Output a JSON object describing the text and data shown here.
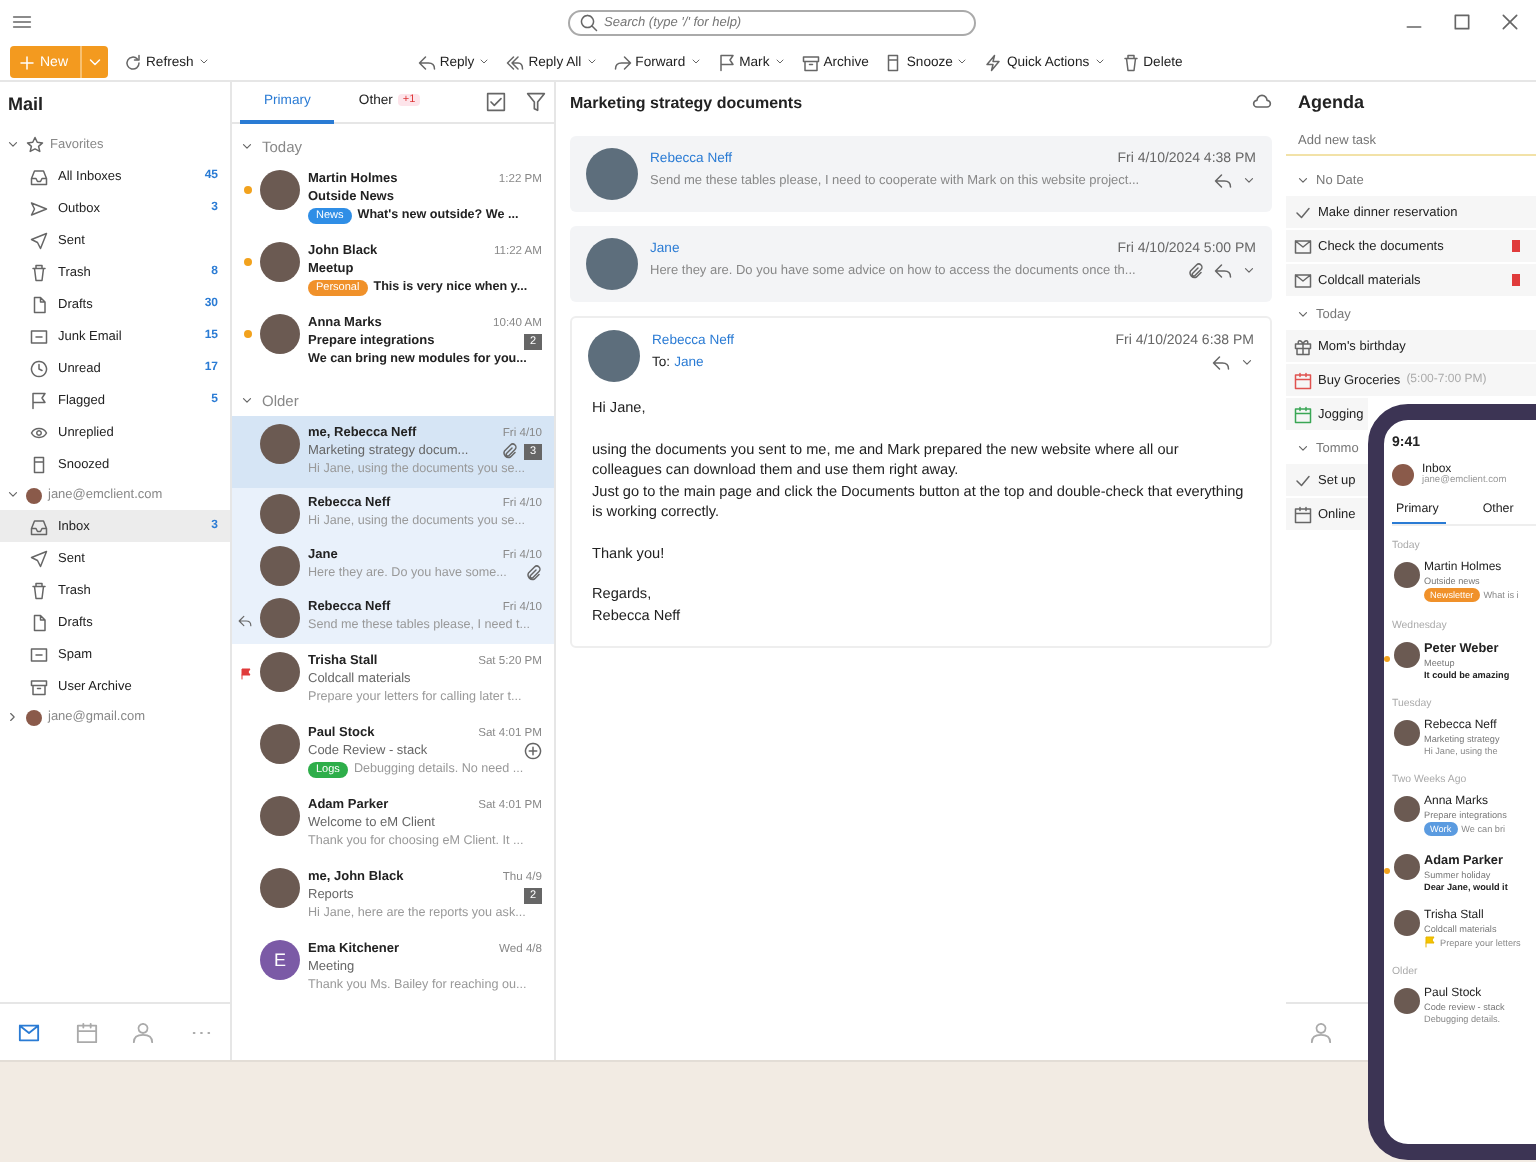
{
  "titlebar": {
    "search": {
      "placeholder": "Search (type '/' for help)"
    }
  },
  "toolbar": {
    "new_button": {
      "label": "New"
    },
    "refresh_button": {
      "label": "Refresh"
    },
    "actions": [
      {
        "label": "Reply",
        "kind": "reply",
        "dropdown": true
      },
      {
        "label": "Reply All",
        "kind": "replyall",
        "dropdown": true
      },
      {
        "label": "Forward",
        "kind": "forward",
        "dropdown": true
      },
      {
        "label": "Mark",
        "kind": "flag",
        "dropdown": true
      },
      {
        "label": "Archive",
        "kind": "archive",
        "dropdown": false
      },
      {
        "label": "Snooze",
        "kind": "snooze",
        "dropdown": true
      },
      {
        "label": "Quick Actions",
        "kind": "bolt",
        "dropdown": true
      },
      {
        "label": "Delete",
        "kind": "trash",
        "dropdown": false
      }
    ]
  },
  "sidebar": {
    "title": "Mail",
    "tree": [
      {
        "label": "Favorites",
        "kind": "favorites",
        "expanded": true,
        "children": [
          {
            "label": "All Inboxes",
            "kind": "inbox",
            "count": "45",
            "selected": false
          },
          {
            "label": "Outbox",
            "kind": "outbox",
            "count": "3",
            "selected": false
          },
          {
            "label": "Sent",
            "kind": "sent",
            "selected": false
          },
          {
            "label": "Trash",
            "kind": "trash",
            "count": "8",
            "selected": false
          },
          {
            "label": "Drafts",
            "kind": "draft",
            "count": "30",
            "selected": false
          },
          {
            "label": "Junk Email",
            "kind": "junk",
            "count": "15",
            "selected": false
          },
          {
            "label": "Unread",
            "kind": "unread",
            "count": "17",
            "selected": false
          },
          {
            "label": "Flagged",
            "kind": "flag",
            "count": "5",
            "selected": false
          },
          {
            "label": "Unreplied",
            "kind": "eye",
            "selected": false
          },
          {
            "label": "Snoozed",
            "kind": "snooze",
            "selected": false
          }
        ]
      },
      {
        "label": "jane@emclient.com",
        "kind": "account",
        "expanded": true,
        "children": [
          {
            "label": "Inbox",
            "kind": "inbox",
            "count": "3",
            "selected": true
          },
          {
            "label": "Sent",
            "kind": "sent",
            "selected": false
          },
          {
            "label": "Trash",
            "kind": "trash",
            "selected": false
          },
          {
            "label": "Drafts",
            "kind": "draft",
            "selected": false
          },
          {
            "label": "Spam",
            "kind": "junk",
            "selected": false
          },
          {
            "label": "User Archive",
            "kind": "archive",
            "selected": false
          }
        ]
      },
      {
        "label": "jane@gmail.com",
        "kind": "account",
        "expanded": false
      }
    ],
    "nav": [
      {
        "kind": "mail",
        "selected": true
      },
      {
        "kind": "calendar",
        "selected": false
      },
      {
        "kind": "contacts",
        "selected": false
      },
      {
        "kind": "more",
        "selected": false
      }
    ]
  },
  "message_list": {
    "tabs": [
      {
        "label": "Primary",
        "selected": true
      },
      {
        "label": "Other",
        "selected": false,
        "badge": "+1"
      }
    ],
    "groups": [
      {
        "label": "Today",
        "expanded": true,
        "messages": [
          {
            "sender": "Martin Holmes",
            "time": "1:22 PM",
            "subject": "Outside News",
            "preview": "What's new outside? We ...",
            "tag": {
              "label": "News",
              "color": "#2f8ee6"
            },
            "unread": true,
            "selected": false
          },
          {
            "sender": "John Black",
            "time": "11:22 AM",
            "subject": "Meetup",
            "preview": "This is very nice when y...",
            "tag": {
              "label": "Personal",
              "color": "#f0912a"
            },
            "unread": true,
            "selected": false
          },
          {
            "sender": "Anna Marks",
            "time": "10:40 AM",
            "subject": "Prepare integrations",
            "preview": "We can bring new modules for you...",
            "count": "2",
            "unread": true,
            "selected": false
          }
        ]
      },
      {
        "label": "Older",
        "expanded": true,
        "messages": [
          {
            "sender": "me, Rebecca Neff",
            "time": "Fri 4/10",
            "subject": "Marketing strategy docum...",
            "preview": "Hi Jane, using the documents you se...",
            "attachment": true,
            "count": "3",
            "unread": false,
            "selected": true
          },
          {
            "sender": "Rebecca Neff",
            "time": "Fri 4/10",
            "preview": "Hi Jane, using the documents you se...",
            "threaded": true,
            "unread": false,
            "selected": false
          },
          {
            "sender": "Jane",
            "time": "Fri 4/10",
            "preview": "Here they are. Do you have some...",
            "attachment": true,
            "threaded": true,
            "unread": false,
            "selected": false
          },
          {
            "sender": "Rebecca Neff",
            "time": "Fri 4/10",
            "preview": "Send me these tables please, I need t...",
            "threaded": true,
            "replied": true,
            "unread": false,
            "selected": false
          },
          {
            "sender": "Trisha Stall",
            "time": "Sat 5:20 PM",
            "subject": "Coldcall materials",
            "preview": "Prepare your letters for calling later t...",
            "flagged": true,
            "unread": false,
            "selected": false
          },
          {
            "sender": "Paul Stock",
            "time": "Sat 4:01 PM",
            "subject": "Code Review - stack",
            "preview": "Debugging details. No need ...",
            "tag": {
              "label": "Logs",
              "color": "#2eae4a"
            },
            "snoozed": true,
            "unread": false,
            "selected": false
          },
          {
            "sender": "Adam Parker",
            "time": "Sat 4:01 PM",
            "subject": "Welcome to eM Client",
            "preview": "Thank you for choosing eM Client. It ...",
            "unread": false,
            "selected": false
          },
          {
            "sender": "me, John Black",
            "time": "Thu 4/9",
            "subject": "Reports",
            "preview": "Hi Jane, here are the reports you ask...",
            "count": "2",
            "unread": false,
            "selected": false
          },
          {
            "sender": "Ema Kitchener",
            "time": "Wed 4/8",
            "subject": "Meeting",
            "preview": "Thank you Ms. Bailey for reaching ou...",
            "initial": "E",
            "unread": false,
            "selected": false
          }
        ]
      }
    ]
  },
  "reading_pane": {
    "title": "Marketing strategy documents",
    "messages": [
      {
        "sender": "Rebecca Neff",
        "date": "Fri 4/10/2024 4:38 PM",
        "snippet": "Send me these tables please, I need to cooperate with Mark on this website project...",
        "expanded": false,
        "attachment": false
      },
      {
        "sender": "Jane",
        "date": "Fri 4/10/2024 5:00 PM",
        "snippet": "Here they are. Do you have some advice on how to access the documents once th...",
        "expanded": false,
        "attachment": true
      },
      {
        "sender": "Rebecca Neff",
        "date": "Fri 4/10/2024 6:38 PM",
        "to_label": "To:",
        "to": "Jane",
        "expanded": true,
        "attachment": false,
        "body": [
          [
            "Hi Jane,"
          ],
          [
            "using the documents you sent to me, me and Mark prepared the new website where all our colleagues can download them and use them right away.",
            "Just go to the main page and click the Documents button at the top and double-check that everything is working correctly."
          ],
          [
            "Thank you!"
          ],
          [
            "Regards,",
            "Rebecca Neff"
          ]
        ]
      }
    ]
  },
  "agenda": {
    "title": "Agenda",
    "new_task": {
      "placeholder": "Add new task"
    },
    "groups": [
      {
        "label": "No Date",
        "expanded": true,
        "items": [
          {
            "label": "Make dinner reservation",
            "kind": "task",
            "flagged": false
          },
          {
            "label": "Check the documents",
            "kind": "mail",
            "flagged": true
          },
          {
            "label": "Coldcall materials",
            "kind": "mail",
            "flagged": true
          }
        ]
      },
      {
        "label": "Today",
        "expanded": true,
        "items": [
          {
            "label": "Mom's birthday",
            "kind": "birthday",
            "flagged": false
          },
          {
            "label": "Buy Groceries",
            "time": "(5:00-7:00 PM)",
            "kind": "event",
            "color": "#e0524f",
            "flagged": false
          },
          {
            "label": "Jogging",
            "kind": "event",
            "color": "#3aa655",
            "flagged": false
          }
        ]
      },
      {
        "label": "Tommo",
        "expanded": true,
        "items": [
          {
            "label": "Set up",
            "kind": "task",
            "flagged": false
          },
          {
            "label": "Online",
            "kind": "meeting",
            "flagged": false
          }
        ]
      }
    ]
  },
  "phone": {
    "time": "9:41",
    "mailbox": "Inbox",
    "account": "jane@emclient.com",
    "tabs": [
      {
        "label": "Primary",
        "selected": true
      },
      {
        "label": "Other",
        "selected": false
      }
    ],
    "groups": [
      {
        "label": "Today",
        "messages": [
          {
            "sender": "Martin Holmes",
            "subject": "Outside news",
            "tag": {
              "label": "Newsletter",
              "color": "#f0912a"
            },
            "preview": "What is i",
            "unread": false
          }
        ]
      },
      {
        "label": "Wednesday",
        "messages": [
          {
            "sender": "Peter Weber",
            "subject": "Meetup",
            "preview": "It could be amazing",
            "unread": true
          }
        ]
      },
      {
        "label": "Tuesday",
        "messages": [
          {
            "sender": "Rebecca Neff",
            "subject": "Marketing strategy",
            "preview": "Hi Jane, using the",
            "unread": false
          }
        ]
      },
      {
        "label": "Two Weeks Ago",
        "messages": [
          {
            "sender": "Anna Marks",
            "subject": "Prepare integrations",
            "tag": {
              "label": "Work",
              "color": "#5b9be0"
            },
            "preview": "We can bri",
            "unread": false
          },
          {
            "sender": "Adam Parker",
            "subject": "Summer holiday",
            "preview": "Dear Jane, would it",
            "unread": true
          },
          {
            "sender": "Trisha Stall",
            "subject": "Coldcall materials",
            "preview": "Prepare your letters",
            "flagged": true,
            "unread": false
          }
        ]
      },
      {
        "label": "Older",
        "messages": [
          {
            "sender": "Paul Stock",
            "subject": "Code review - stack",
            "preview": "Debugging details.",
            "unread": false
          }
        ]
      }
    ]
  }
}
